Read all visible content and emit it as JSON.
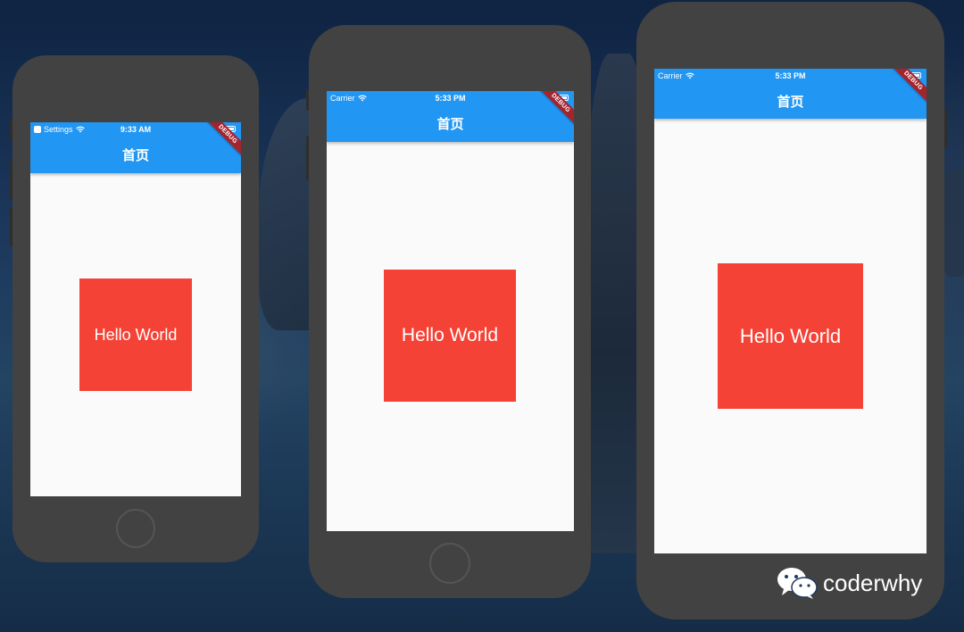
{
  "phones": [
    {
      "status_left": "Settings",
      "status_time": "9:33 AM",
      "appbar_title": "首页",
      "debug_label": "DEBUG",
      "box_text": "Hello World"
    },
    {
      "status_left": "Carrier",
      "status_time": "5:33 PM",
      "appbar_title": "首页",
      "debug_label": "DEBUG",
      "box_text": "Hello World"
    },
    {
      "status_left": "Carrier",
      "status_time": "5:33 PM",
      "appbar_title": "首页",
      "debug_label": "DEBUG",
      "box_text": "Hello World"
    }
  ],
  "watermark": {
    "text": "coderwhy",
    "icon": "wechat-icon"
  },
  "colors": {
    "appbar": "#2196f3",
    "box": "#f44336",
    "debug_banner": "#a4242e",
    "phone_frame": "#424242"
  }
}
